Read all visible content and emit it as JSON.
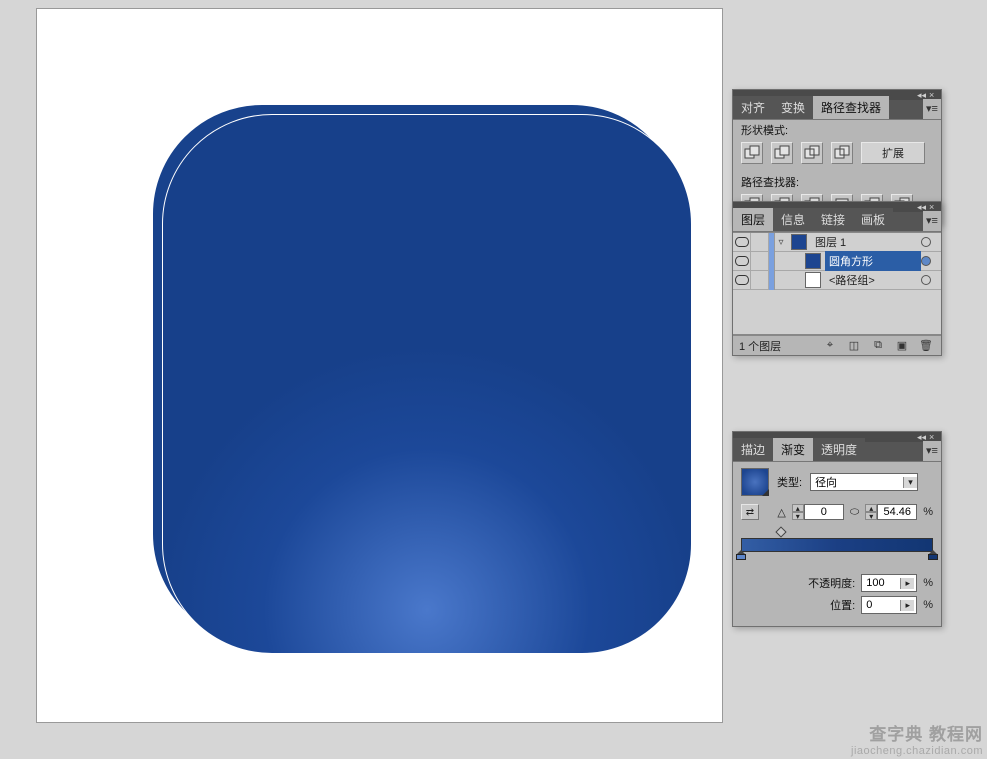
{
  "pathfinder": {
    "tabs": {
      "align": "对齐",
      "transform": "变换",
      "pathfinder": "路径查找器"
    },
    "shape_modes_label": "形状模式:",
    "expand_label": "扩展",
    "pathfinders_label": "路径查找器:",
    "shape_mode_icons": [
      "unite-icon",
      "minus-front-icon",
      "intersect-icon",
      "exclude-icon"
    ],
    "pf_icons": [
      "divide-icon",
      "trim-icon",
      "merge-icon",
      "crop-icon",
      "outline-icon",
      "minus-back-icon"
    ]
  },
  "layers": {
    "tabs": {
      "layers": "图层",
      "info": "信息",
      "links": "链接",
      "artboards": "画板"
    },
    "items": [
      {
        "name": "图层 1",
        "thumb": "#1d4590",
        "indent": 0,
        "expanded": true,
        "selected": false,
        "target": false
      },
      {
        "name": "圆角方形",
        "thumb": "#1d4590",
        "indent": 1,
        "expanded": false,
        "selected": true,
        "target": true
      },
      {
        "name": "<路径组>",
        "thumb": "#ffffff",
        "indent": 1,
        "expanded": false,
        "selected": false,
        "target": false
      }
    ],
    "footer_count": "1 个图层"
  },
  "gradient": {
    "tabs": {
      "stroke": "描边",
      "gradient": "渐变",
      "transparency": "透明度"
    },
    "type_label": "类型:",
    "type_value": "径向",
    "angle_value": "0",
    "ratio_value": "54.46",
    "ratio_suffix": "%",
    "stop_positions_percent": [
      0,
      100
    ],
    "diamond_positions_percent": [
      21
    ],
    "stop_colors": [
      "#5e86c9",
      "#133672"
    ],
    "opacity_label": "不透明度:",
    "opacity_value": "100",
    "opacity_suffix": "%",
    "location_label": "位置:",
    "location_value": "0",
    "location_suffix": "%"
  },
  "watermark": {
    "line1": "查字典 教程网",
    "line2": "jiaocheng.chazidian.com"
  },
  "chart_data": {
    "type": "other",
    "title": "Illustrator rounded square with radial gradient",
    "note": "Artwork is a rounded-square filled with a radial gradient; no axis data."
  }
}
